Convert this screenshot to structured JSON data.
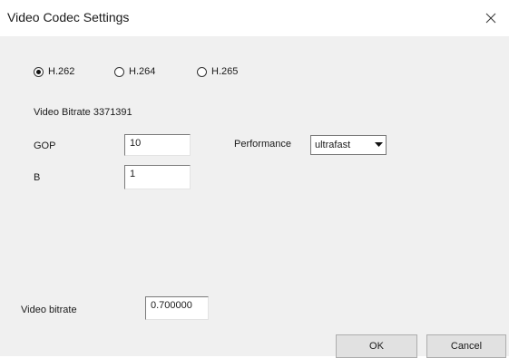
{
  "window": {
    "title": "Video Codec Settings",
    "close_glyph": "✕"
  },
  "codec": {
    "options": [
      {
        "label": "H.262",
        "checked": true
      },
      {
        "label": "H.264",
        "checked": false
      },
      {
        "label": "H.265",
        "checked": false
      }
    ]
  },
  "bitrate_info": {
    "text": "Video Bitrate 3371391"
  },
  "gop": {
    "label": "GOP",
    "value": "10"
  },
  "b": {
    "label": "B",
    "value": "1"
  },
  "performance": {
    "label": "Performance",
    "selected": "ultrafast"
  },
  "video_bitrate": {
    "label": "Video bitrate",
    "value": "0.700000"
  },
  "buttons": {
    "ok": "OK",
    "cancel": "Cancel"
  }
}
